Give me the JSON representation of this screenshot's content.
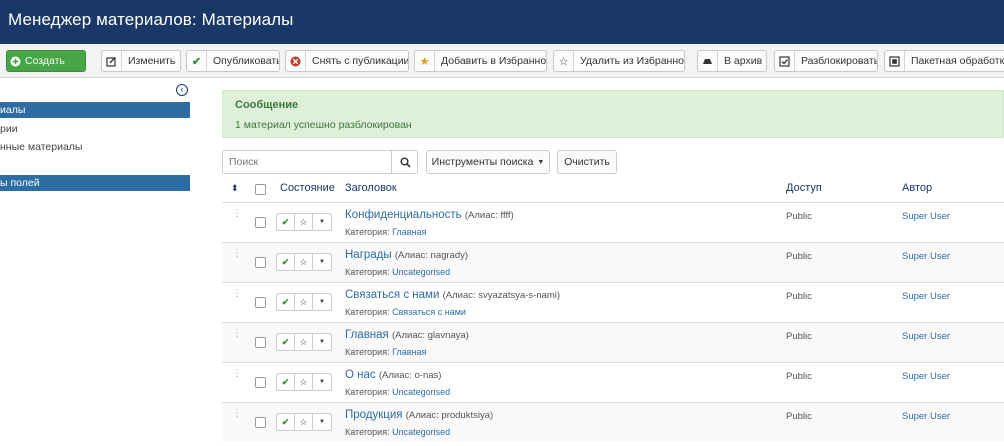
{
  "header": {
    "title": "Менеджер материалов: Материалы"
  },
  "toolbar": {
    "buttons": [
      {
        "label": "Создать",
        "icon": "plus-circle-icon"
      },
      {
        "label": "Изменить",
        "icon": "edit-icon"
      },
      {
        "label": "Опубликовать",
        "icon": "check-icon"
      },
      {
        "label": "Снять с публикации",
        "icon": "unpublish-icon"
      },
      {
        "label": "Добавить в Избранное",
        "icon": "star-filled-icon"
      },
      {
        "label": "Удалить из Избранного",
        "icon": "star-outline-icon"
      },
      {
        "label": "В архив",
        "icon": "archive-icon"
      },
      {
        "label": "Разблокировать",
        "icon": "checkin-icon"
      },
      {
        "label": "Пакетная обработка",
        "icon": "batch-icon"
      }
    ]
  },
  "sidebar": {
    "items": [
      {
        "label": "иалы"
      },
      {
        "label": "рии"
      },
      {
        "label": "нные материалы"
      },
      {
        "label": "ы полей"
      }
    ]
  },
  "message": {
    "heading": "Сообщение",
    "text": "1 материал успешно разблокирован"
  },
  "filters": {
    "search_placeholder": "Поиск",
    "search_tools_label": "Инструменты поиска",
    "clear_label": "Очистить"
  },
  "table": {
    "columns": {
      "state": "Состояние",
      "title": "Заголовок",
      "access": "Доступ",
      "author": "Автор"
    },
    "category_prefix": "Категория:",
    "rows": [
      {
        "title": "Конфиденциальность",
        "alias": "(Алиас: ffff)",
        "category": "Главная",
        "access": "Public",
        "author": "Super User"
      },
      {
        "title": "Награды",
        "alias": "(Алиас: nagrady)",
        "category": "Uncategorised",
        "access": "Public",
        "author": "Super User"
      },
      {
        "title": "Связаться с нами",
        "alias": "(Алиас: svyazatsya-s-nami)",
        "category": "Связаться с нами",
        "access": "Public",
        "author": "Super User"
      },
      {
        "title": "Главная",
        "alias": "(Алиас: glavnaya)",
        "category": "Главная",
        "access": "Public",
        "author": "Super User"
      },
      {
        "title": "О нас",
        "alias": "(Алиас: o-nas)",
        "category": "Uncategorised",
        "access": "Public",
        "author": "Super User"
      },
      {
        "title": "Продукция",
        "alias": "(Алиас: produktsiya)",
        "category": "Uncategorised",
        "access": "Public",
        "author": "Super User"
      }
    ]
  },
  "colors": {
    "header_bg": "#1a3867",
    "create_green": "#46a546",
    "sidebar_active": "#2d6ca2",
    "alert_bg": "#dff0d8",
    "alert_text": "#3c763d",
    "link": "#2d6ca2"
  }
}
